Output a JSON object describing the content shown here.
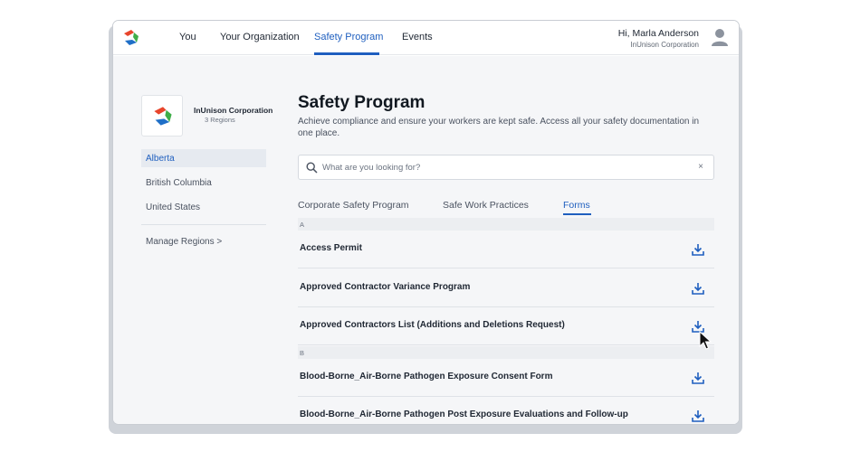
{
  "nav": {
    "items": [
      {
        "label": "You"
      },
      {
        "label": "Your Organization"
      },
      {
        "label": "Safety Program"
      },
      {
        "label": "Events"
      }
    ],
    "active": "Safety Program",
    "user_greeting": "Hi, Marla Anderson",
    "user_org": "InUnison Corporation"
  },
  "sidebar": {
    "org_name": "InUnison Corporation",
    "org_regions": "3 Regions",
    "regions": [
      {
        "label": "Alberta",
        "active": true
      },
      {
        "label": "British Columbia",
        "active": false
      },
      {
        "label": "United States",
        "active": false
      }
    ],
    "manage_label": "Manage Regions >"
  },
  "main": {
    "title": "Safety Program",
    "subtitle": "Achieve compliance and ensure your workers are kept safe. Access all your safety documentation in one place.",
    "search_placeholder": "What are you looking for?",
    "search_clear": "×",
    "tabs": [
      {
        "label": "Corporate Safety Program"
      },
      {
        "label": "Safe Work Practices"
      },
      {
        "label": "Forms"
      }
    ],
    "active_tab": "Forms",
    "groups": [
      {
        "letter": "A",
        "forms": [
          "Access Permit",
          "Approved Contractor Variance Program",
          "Approved Contractors List (Additions and Deletions Request)"
        ]
      },
      {
        "letter": "B",
        "forms": [
          "Blood-Borne_Air-Borne Pathogen Exposure Consent Form",
          "Blood-Borne_Air-Borne Pathogen Post Exposure Evaluations and Follow-up"
        ]
      }
    ]
  },
  "colors": {
    "accent": "#1f5fbf",
    "logo_red": "#e8452c",
    "logo_green": "#3fae49",
    "logo_blue": "#1f6fc7"
  },
  "icons": [
    "inunison-logo-icon",
    "user-avatar-icon",
    "search-icon",
    "clear-icon",
    "download-icon",
    "mouse-pointer-icon"
  ]
}
